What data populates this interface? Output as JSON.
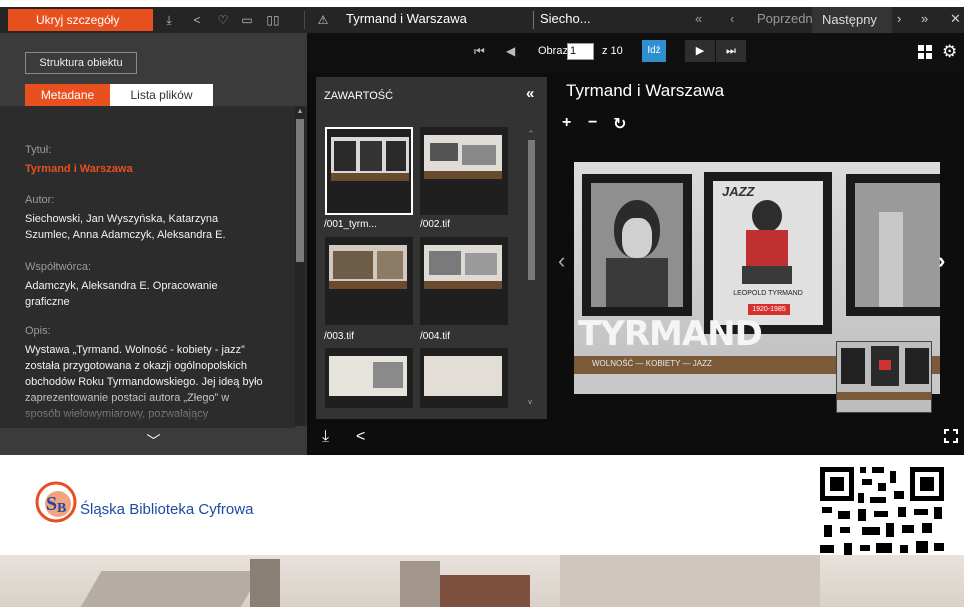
{
  "topbar": {
    "hide_details": "Ukryj szczegóły",
    "title": "Tyrmand i Warszawa",
    "author": "Siecho...",
    "prev": "Poprzedni",
    "next": "Następny"
  },
  "left": {
    "structure_btn": "Struktura obiektu",
    "tabs": [
      "Metadane",
      "Lista plików"
    ],
    "metadata": {
      "title_label": "Tytuł:",
      "title_value": "Tyrmand i Warszawa",
      "author_label": "Autor:",
      "author_value": "Siechowski, Jan   Wyszyńska, Katarzyna   Szumlec, Anna   Adamczyk, Aleksandra E.",
      "contrib_label": "Współtwórca:",
      "contrib_value": "Adamczyk, Aleksandra E. Opracowanie graficzne",
      "desc_label": "Opis:",
      "desc_value": "Wystawa „Tyrmand. Wolność - kobiety - jazz” została przygotowana z okazji ogólnopolskich obchodów Roku Tyrmandowskiego. Jej ideą było zaprezentowanie postaci autora „Złego” w sposób wielowymiarowy, pozwalający"
    }
  },
  "viewer": {
    "page_label": "Obraz",
    "page_value": "1",
    "page_of": "z 10",
    "go_label": "Idź",
    "contents_header": "ZAWARTOŚĆ",
    "thumbs": [
      "/001_tyrm...",
      "/002.tif",
      "/003.tif",
      "/004.tif"
    ],
    "object_title": "Tyrmand i Warszawa",
    "poster": {
      "title": "TYRMAND",
      "subtitle": "WOLNOŚĆ — KOBIETY — JAZZ",
      "jazz": "JAZZ",
      "name": "LEOPOLD TYRMAND",
      "years": "1920-1985"
    }
  },
  "footer": {
    "logo_text": "Śląska Biblioteka Cyfrowa"
  },
  "colors": {
    "accent": "#e8501f",
    "go_blue": "#2f8fd1",
    "logo_blue": "#1b4aa0"
  }
}
